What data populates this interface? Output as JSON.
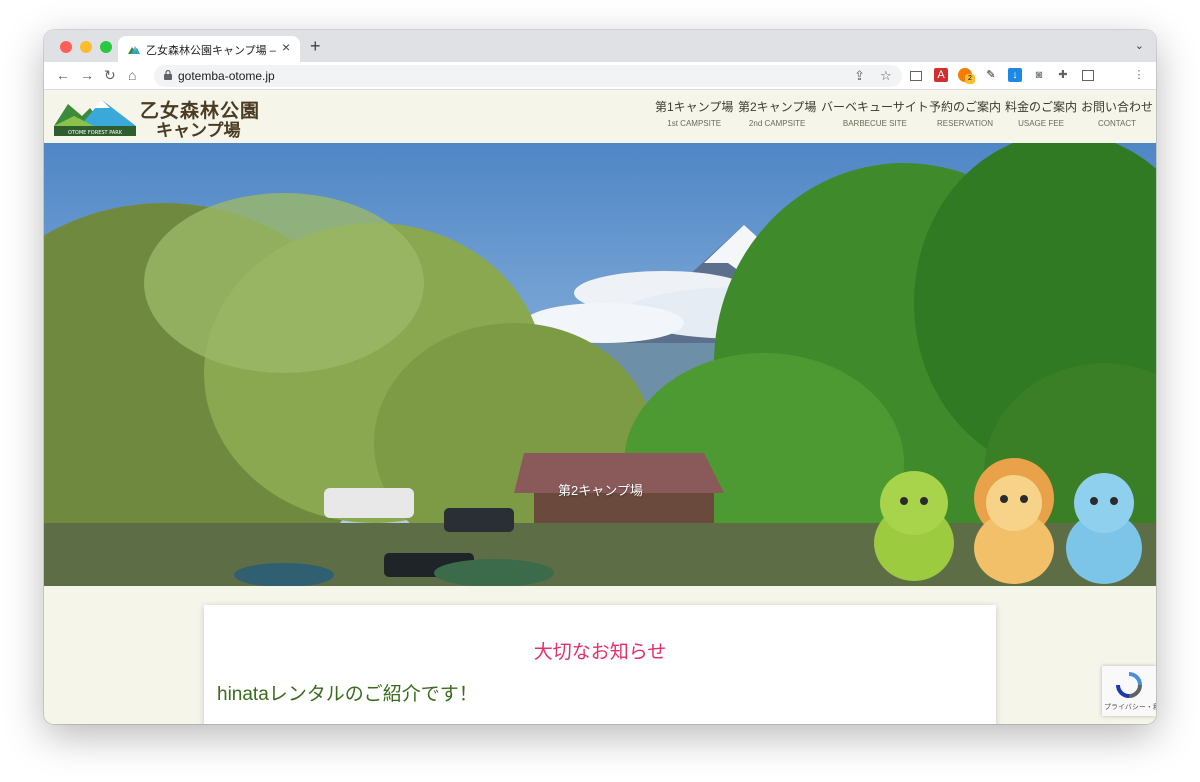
{
  "browser": {
    "tab_title": "乙女森林公園キャンプ場 – 静岡県御",
    "url": "gotemba-otome.jp",
    "new_tab_label": "+",
    "ext_badge": "2"
  },
  "site": {
    "logo_line1": "乙女森林公園",
    "logo_line2": "キャンプ場",
    "logo_caption": "OTOME FOREST PARK",
    "nav": [
      {
        "jp": "第1キャンプ場",
        "en": "1st CAMPSITE"
      },
      {
        "jp": "第2キャンプ場",
        "en": "2nd CAMPSITE"
      },
      {
        "jp": "バーベキューサイト",
        "en": "BARBECUE SITE"
      },
      {
        "jp": "予約のご案内",
        "en": "RESERVATION"
      },
      {
        "jp": "料金のご案内",
        "en": "USAGE FEE"
      },
      {
        "jp": "お問い合わせ",
        "en": "CONTACT"
      }
    ]
  },
  "hero": {
    "label": "第2キャンプ場"
  },
  "notice": {
    "title": "大切なお知らせ",
    "link": "hinataレンタルのご紹介です！"
  },
  "recaptcha": {
    "text": "プライバシー・利用規約"
  },
  "colors": {
    "page_bg": "#f5f5ea",
    "notice_title": "#e0306e",
    "notice_link": "#3a6b1e"
  }
}
